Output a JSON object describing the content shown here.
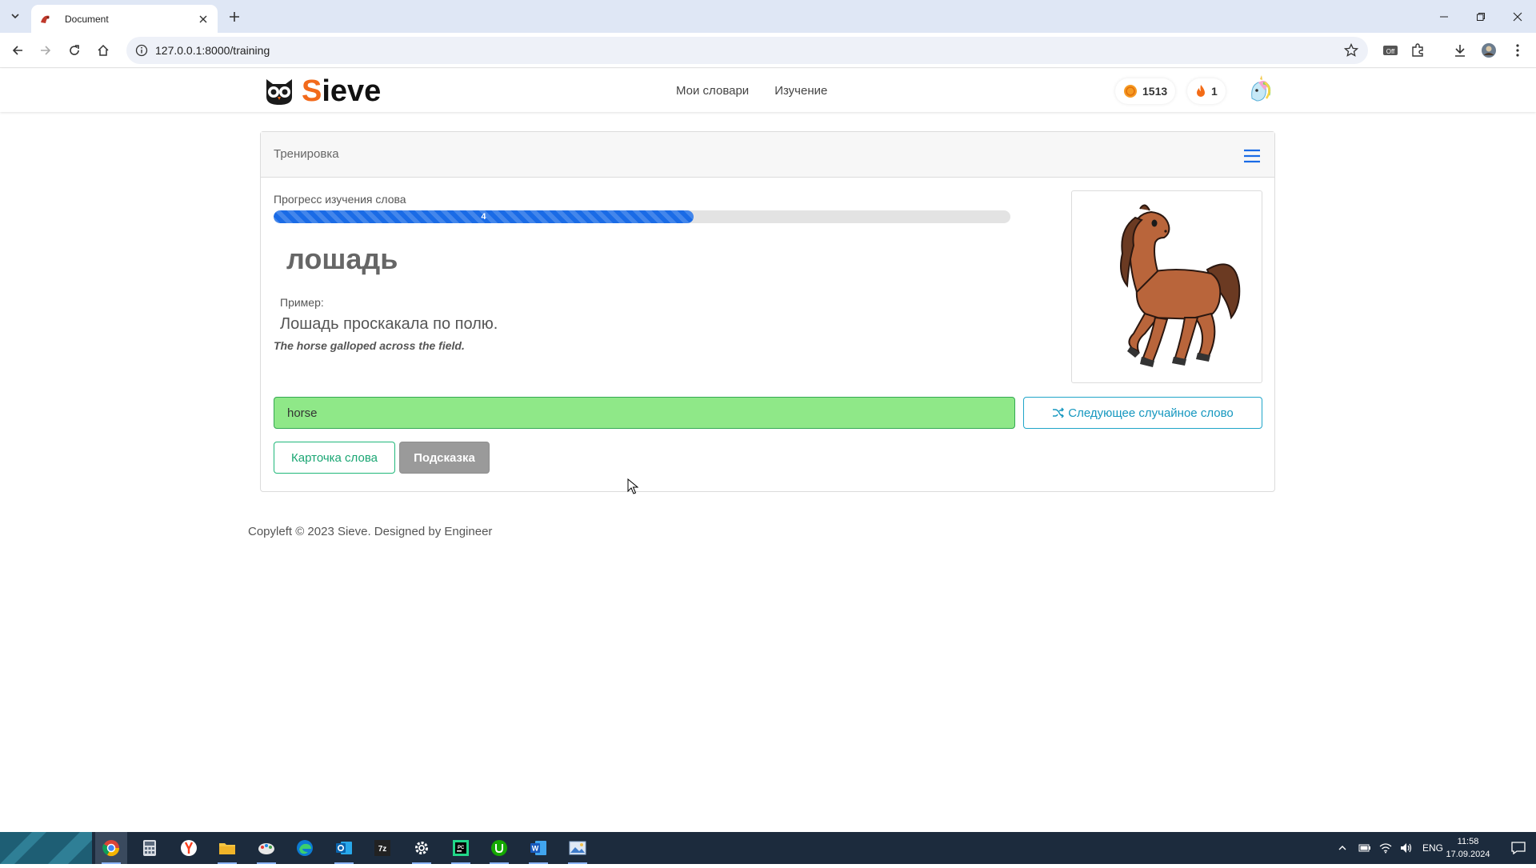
{
  "browser": {
    "tab_title": "Document",
    "url": "127.0.0.1:8000/training"
  },
  "site": {
    "brand_first": "S",
    "brand_rest": "ieve",
    "nav": [
      "Мои словари",
      "Изучение"
    ],
    "coins": "1513",
    "streak": "1"
  },
  "training": {
    "header": "Тренировка",
    "progress_label": "Прогресс изучения слова",
    "progress_value": "4",
    "progress_fraction": 0.57,
    "word": "лошадь",
    "example_label": "Пример:",
    "example_ru": "Лошадь проскакала по полю.",
    "example_en": "The horse galloped across the field.",
    "answer_value": "horse",
    "next_button": "Следующее случайное слово",
    "card_button": "Карточка слова",
    "hint_button": "Подсказка"
  },
  "footer": {
    "text": "Copyleft © 2023 Sieve. Designed by Engineer"
  },
  "taskbar": {
    "language": "ENG",
    "time": "11:58",
    "date": "17.09.2024"
  },
  "colors": {
    "accent_orange": "#f26a1b",
    "progress_blue": "#1a6be6",
    "answer_green": "#8fe888",
    "info_blue": "#1597bf",
    "success_green": "#1aa673"
  }
}
